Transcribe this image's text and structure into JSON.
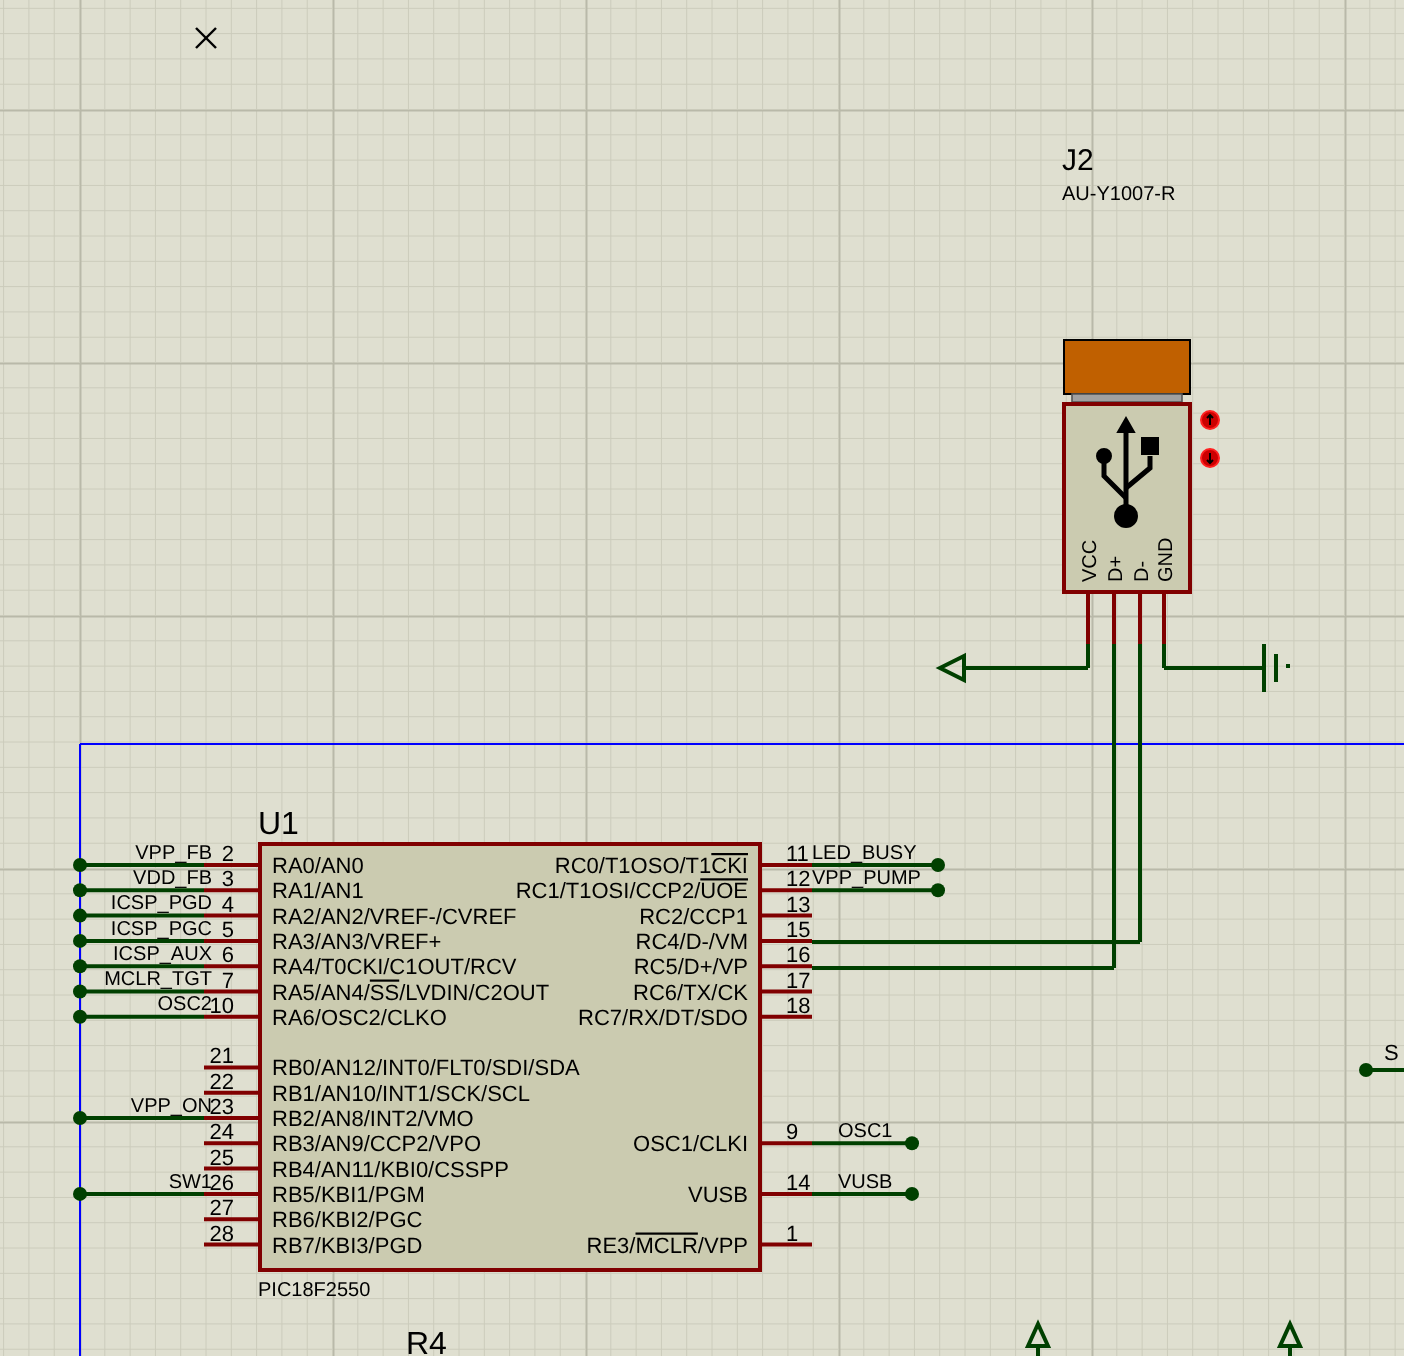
{
  "connector": {
    "ref": "J2",
    "value": "AU-Y1007-R",
    "pins": [
      {
        "label": "VCC"
      },
      {
        "label": "D+"
      },
      {
        "label": "D-"
      },
      {
        "label": "GND"
      }
    ]
  },
  "chip": {
    "ref": "U1",
    "part": "PIC18F2550",
    "left_pins": [
      {
        "number": "2",
        "name": [
          {
            "text": "RA0/AN0"
          }
        ],
        "net": "VPP_FB"
      },
      {
        "number": "3",
        "name": [
          {
            "text": "RA1/AN1"
          }
        ],
        "net": "VDD_FB"
      },
      {
        "number": "4",
        "name": [
          {
            "text": "RA2/AN2/VREF-/CVREF"
          }
        ],
        "net": "ICSP_PGD"
      },
      {
        "number": "5",
        "name": [
          {
            "text": "RA3/AN3/VREF+"
          }
        ],
        "net": "ICSP_PGC"
      },
      {
        "number": "6",
        "name": [
          {
            "text": "RA4/T0CKI/C1OUT/RCV"
          }
        ],
        "net": "ICSP_AUX"
      },
      {
        "number": "7",
        "name": [
          {
            "text": "RA5/AN4/"
          },
          {
            "text": "SS",
            "overline": true
          },
          {
            "text": "/LVDIN/C2OUT"
          }
        ],
        "net": "MCLR_TGT"
      },
      {
        "number": "10",
        "name": [
          {
            "text": "RA6/OSC2/CLKO"
          }
        ],
        "net": "OSC2"
      },
      {
        "number": "21",
        "name": [
          {
            "text": "RB0/AN12/INT0/FLT0/SDI/SDA"
          }
        ]
      },
      {
        "number": "22",
        "name": [
          {
            "text": "RB1/AN10/INT1/SCK/SCL"
          }
        ]
      },
      {
        "number": "23",
        "name": [
          {
            "text": "RB2/AN8/INT2/VMO"
          }
        ],
        "net": "VPP_ON"
      },
      {
        "number": "24",
        "name": [
          {
            "text": "RB3/AN9/CCP2/VPO"
          }
        ]
      },
      {
        "number": "25",
        "name": [
          {
            "text": "RB4/AN11/KBI0/CSSPP"
          }
        ]
      },
      {
        "number": "26",
        "name": [
          {
            "text": "RB5/KBI1/PGM"
          }
        ],
        "net": "SW1"
      },
      {
        "number": "27",
        "name": [
          {
            "text": "RB6/KBI2/PGC"
          }
        ]
      },
      {
        "number": "28",
        "name": [
          {
            "text": "RB7/KBI3/PGD"
          }
        ]
      }
    ],
    "right_pins": [
      {
        "number": "11",
        "name": [
          {
            "text": "RC0/T1OSO/T1"
          },
          {
            "text": "CKI",
            "overline": true
          }
        ],
        "net": "LED_BUSY"
      },
      {
        "number": "12",
        "name": [
          {
            "text": "RC1/T1OSI/CCP2/"
          },
          {
            "text": "UOE",
            "overline": true
          }
        ],
        "net": "VPP_PUMP"
      },
      {
        "number": "13",
        "name": [
          {
            "text": "RC2/CCP1"
          }
        ]
      },
      {
        "number": "15",
        "name": [
          {
            "text": "RC4/D-/VM"
          }
        ]
      },
      {
        "number": "16",
        "name": [
          {
            "text": "RC5/D+/VP"
          }
        ]
      },
      {
        "number": "17",
        "name": [
          {
            "text": "RC6/TX/CK"
          }
        ]
      },
      {
        "number": "18",
        "name": [
          {
            "text": "RC7/RX/DT/SDO"
          }
        ]
      },
      {
        "number": "9",
        "name": [
          {
            "text": "OSC1/CLKI"
          }
        ],
        "net": "OSC1"
      },
      {
        "number": "14",
        "name": [
          {
            "text": "VUSB"
          }
        ],
        "net": "VUSB"
      },
      {
        "number": "1",
        "name": [
          {
            "text": "RE3/"
          },
          {
            "text": "MCLR",
            "overline": true
          },
          {
            "text": "/VPP"
          }
        ]
      }
    ]
  },
  "resistor": {
    "ref": "R4"
  },
  "edge_net": {
    "label": "S"
  }
}
